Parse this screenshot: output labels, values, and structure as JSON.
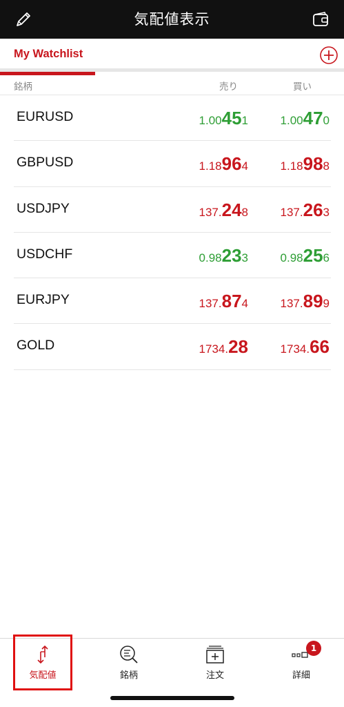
{
  "header": {
    "title": "気配値表示"
  },
  "tabs": {
    "active_label": "My Watchlist"
  },
  "columns": {
    "symbol": "銘柄",
    "bid": "売り",
    "ask": "買い"
  },
  "colors": {
    "up": "#2e9e35",
    "down": "#c8161d",
    "accent": "#c8161d",
    "header_bg": "#111111"
  },
  "rows": [
    {
      "symbol": "EURUSD",
      "bid": {
        "pre": "1.00",
        "big": "45",
        "post": "1",
        "direction": "up"
      },
      "ask": {
        "pre": "1.00",
        "big": "47",
        "post": "0",
        "direction": "up"
      }
    },
    {
      "symbol": "GBPUSD",
      "bid": {
        "pre": "1.18",
        "big": "96",
        "post": "4",
        "direction": "down"
      },
      "ask": {
        "pre": "1.18",
        "big": "98",
        "post": "8",
        "direction": "down"
      }
    },
    {
      "symbol": "USDJPY",
      "bid": {
        "pre": "137.",
        "big": "24",
        "post": "8",
        "direction": "down"
      },
      "ask": {
        "pre": "137.",
        "big": "26",
        "post": "3",
        "direction": "down"
      }
    },
    {
      "symbol": "USDCHF",
      "bid": {
        "pre": "0.98",
        "big": "23",
        "post": "3",
        "direction": "up"
      },
      "ask": {
        "pre": "0.98",
        "big": "25",
        "post": "6",
        "direction": "up"
      }
    },
    {
      "symbol": "EURJPY",
      "bid": {
        "pre": "137.",
        "big": "87",
        "post": "4",
        "direction": "down"
      },
      "ask": {
        "pre": "137.",
        "big": "89",
        "post": "9",
        "direction": "down"
      }
    },
    {
      "symbol": "GOLD",
      "bid": {
        "pre": "1734.",
        "big": "28",
        "post": "",
        "direction": "down"
      },
      "ask": {
        "pre": "1734.",
        "big": "66",
        "post": "",
        "direction": "down"
      }
    }
  ],
  "bottom_nav": {
    "items": [
      {
        "label": "気配値",
        "icon": "quotes-icon",
        "active": true
      },
      {
        "label": "銘柄",
        "icon": "search-list-icon",
        "active": false
      },
      {
        "label": "注文",
        "icon": "order-icon",
        "active": false
      },
      {
        "label": "詳細",
        "icon": "more-icon",
        "active": false
      }
    ],
    "detail_badge": "1"
  }
}
